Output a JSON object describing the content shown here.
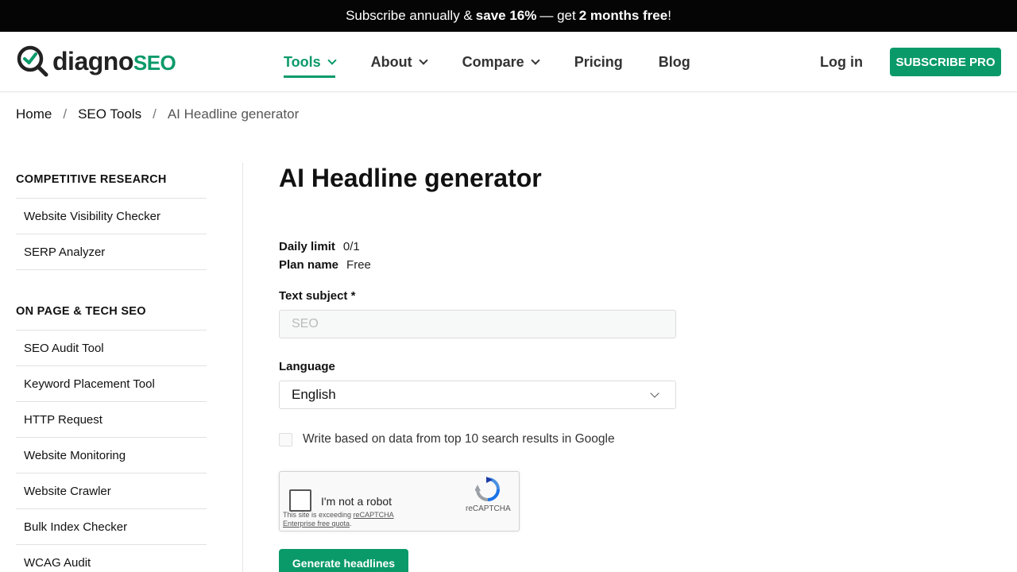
{
  "promo": {
    "part1": "Subscribe annually &",
    "bold1": "save 16%",
    "part2": "— get",
    "bold2": "2 months free",
    "part3": "!"
  },
  "header": {
    "logo_main": "diagno",
    "logo_accent": "SEO",
    "nav": [
      {
        "label": "Tools",
        "has_dropdown": true,
        "active": true
      },
      {
        "label": "About",
        "has_dropdown": true
      },
      {
        "label": "Compare",
        "has_dropdown": true
      },
      {
        "label": "Pricing"
      },
      {
        "label": "Blog"
      }
    ],
    "login": "Log in",
    "subscribe": "SUBSCRIBE PRO"
  },
  "breadcrumb": {
    "home": "Home",
    "tools": "SEO Tools",
    "current": "AI Headline generator",
    "separator": "/"
  },
  "sidebar": {
    "sections": [
      {
        "title": "COMPETITIVE RESEARCH",
        "items": [
          "Website Visibility Checker",
          "SERP Analyzer"
        ]
      },
      {
        "title": "ON PAGE & TECH SEO",
        "items": [
          "SEO Audit Tool",
          "Keyword Placement Tool",
          "HTTP Request",
          "Website Monitoring",
          "Website Crawler",
          "Bulk Index Checker",
          "WCAG Audit"
        ]
      }
    ]
  },
  "main": {
    "title": "AI Headline generator",
    "daily_limit_label": "Daily limit",
    "daily_limit_value": "0/1",
    "plan_label": "Plan name",
    "plan_value": "Free",
    "subject_label": "Text subject *",
    "subject_placeholder": "SEO",
    "language_label": "Language",
    "language_value": "English",
    "checkbox_label": "Write based on data from top 10 search results in Google",
    "recaptcha": {
      "label": "I'm not a robot",
      "brand": "reCAPTCHA",
      "note_prefix": "This site is exceeding",
      "note_link1": "reCAPTCHA",
      "note_link2": "Enterprise free quota",
      "note_suffix": "."
    },
    "generate_button": "Generate headlines"
  },
  "colors": {
    "brand_green": "#0a9a6a",
    "promo_bg": "#050505"
  }
}
